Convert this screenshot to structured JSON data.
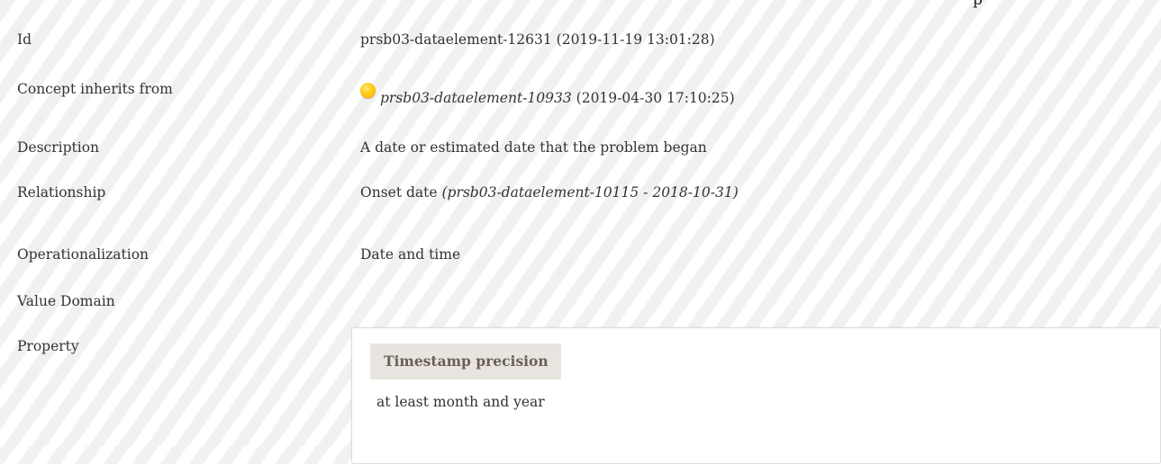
{
  "header": {
    "top_text": "p"
  },
  "fields": {
    "id": {
      "label": "Id",
      "value": "prsb03-dataelement-12631 (2019-11-19 13:01:28)"
    },
    "inherits": {
      "label": "Concept inherits from",
      "status_icon": "status-circle-icon",
      "status_color": "#ffcc11",
      "link_text": "prsb03-dataelement-10933",
      "suffix": " (2019-04-30 17:10:25)"
    },
    "description": {
      "label": "Description",
      "value": "A date or estimated date that the problem began"
    },
    "relationship": {
      "label": "Relationship",
      "value": "Onset date ",
      "ref": "(prsb03-dataelement-10115 - 2018-10-31)"
    },
    "operationalization": {
      "label": "Operationalization",
      "value": "Date and time"
    },
    "value_domain": {
      "label": "Value Domain",
      "value": ""
    },
    "property": {
      "label": "Property",
      "name": "Timestamp precision",
      "value": "at least month and year"
    }
  }
}
